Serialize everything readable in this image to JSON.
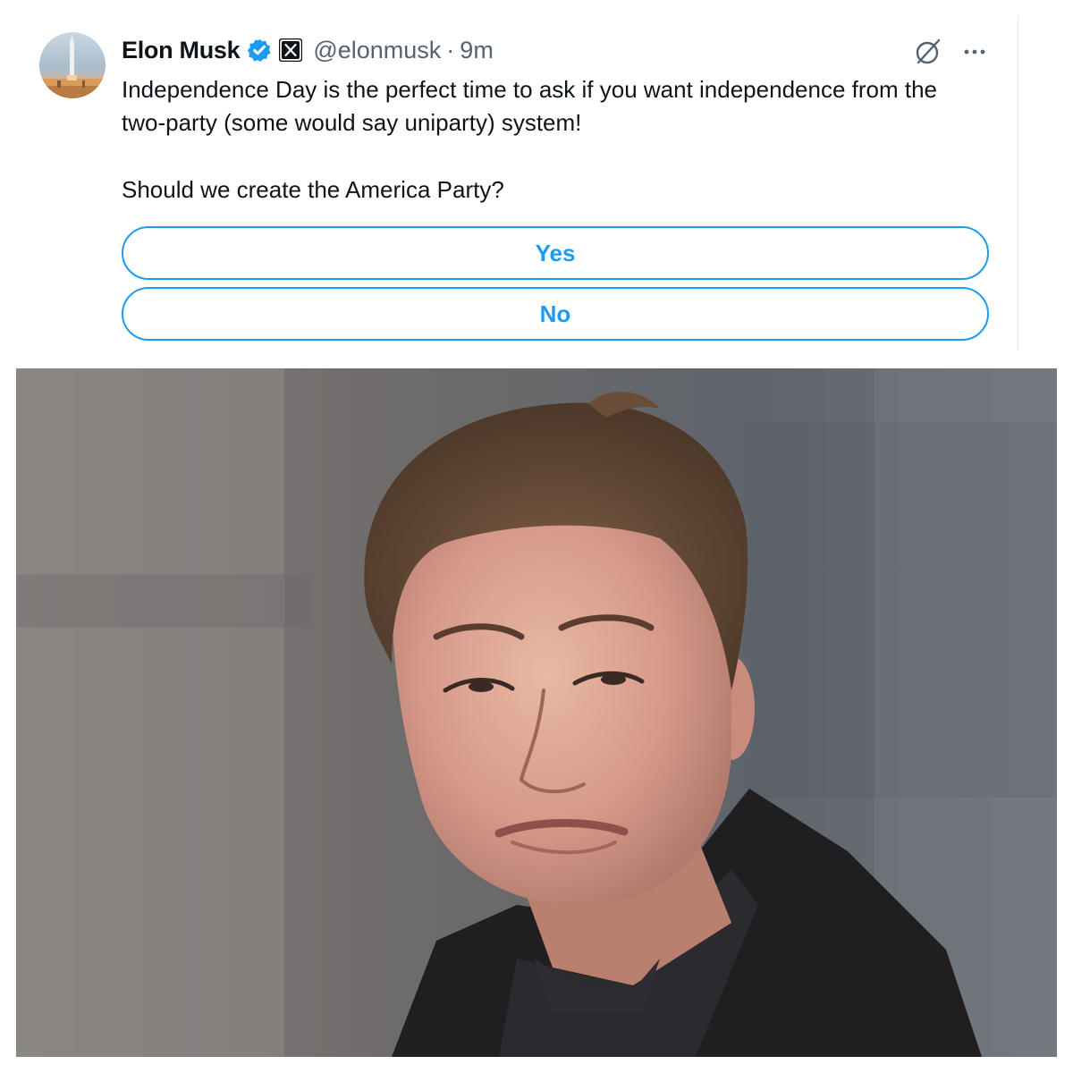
{
  "tweet": {
    "author": {
      "display_name": "Elon Musk",
      "handle": "@elonmusk",
      "verified_icon": "verified-badge-icon",
      "affiliate_icon": "x-logo-icon"
    },
    "separator": "·",
    "timestamp": "9m",
    "actions": {
      "grok_icon": "grok-icon",
      "more_icon": "more-options-icon"
    },
    "text_paragraph_1": "Independence Day is the perfect time to ask if you want independence from the two-party (some would say uniparty) system!",
    "text_paragraph_2": "Should we create the America Party?",
    "poll": {
      "options": [
        {
          "label": "Yes"
        },
        {
          "label": "No"
        }
      ]
    }
  },
  "colors": {
    "accent": "#1d9bf0",
    "text_primary": "#0f1419",
    "text_secondary": "#536471"
  }
}
